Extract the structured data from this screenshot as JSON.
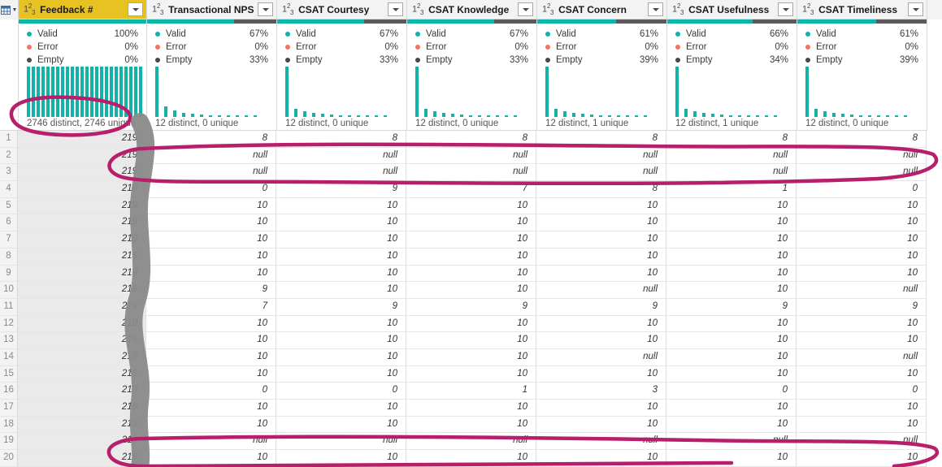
{
  "app": {
    "corner_icon": "table-select-all-icon",
    "type_icon_label": "123"
  },
  "columns": [
    {
      "name": "Feedback #",
      "selected": true,
      "type": "whole-number",
      "filter_icon": "filter-dropdown-icon",
      "quality": {
        "valid_label": "Valid",
        "valid": "100%",
        "error_label": "Error",
        "error": "0%",
        "empty_label": "Empty",
        "empty": "0%"
      },
      "quality_pct": {
        "valid": 100,
        "error": 0,
        "empty": 0
      },
      "distinct": "2746 distinct, 2746 unique",
      "histogram": [
        62,
        62,
        62,
        62,
        62,
        62,
        62,
        62,
        62,
        62,
        62,
        62,
        62,
        62,
        62,
        62,
        62,
        62,
        62,
        62,
        62,
        62,
        62,
        62
      ]
    },
    {
      "name": "Transactional NPS",
      "selected": false,
      "type": "whole-number",
      "filter_icon": "filter-dropdown-icon",
      "quality": {
        "valid_label": "Valid",
        "valid": "67%",
        "error_label": "Error",
        "error": "0%",
        "empty_label": "Empty",
        "empty": "33%"
      },
      "quality_pct": {
        "valid": 67,
        "error": 0,
        "empty": 33
      },
      "distinct": "12 distinct, 0 unique",
      "histogram": [
        62,
        13,
        8,
        5,
        4,
        3,
        2,
        2,
        2,
        2,
        2,
        2
      ]
    },
    {
      "name": "CSAT Courtesy",
      "selected": false,
      "type": "whole-number",
      "filter_icon": "filter-dropdown-icon",
      "quality": {
        "valid_label": "Valid",
        "valid": "67%",
        "error_label": "Error",
        "error": "0%",
        "empty_label": "Empty",
        "empty": "33%"
      },
      "quality_pct": {
        "valid": 67,
        "error": 0,
        "empty": 33
      },
      "distinct": "12 distinct, 0 unique",
      "histogram": [
        62,
        10,
        7,
        5,
        4,
        3,
        2,
        2,
        2,
        2,
        2,
        2
      ]
    },
    {
      "name": "CSAT Knowledge",
      "selected": false,
      "type": "whole-number",
      "filter_icon": "filter-dropdown-icon",
      "quality": {
        "valid_label": "Valid",
        "valid": "67%",
        "error_label": "Error",
        "error": "0%",
        "empty_label": "Empty",
        "empty": "33%"
      },
      "quality_pct": {
        "valid": 67,
        "error": 0,
        "empty": 33
      },
      "distinct": "12 distinct, 0 unique",
      "histogram": [
        62,
        10,
        7,
        5,
        4,
        3,
        2,
        2,
        2,
        2,
        2,
        2
      ]
    },
    {
      "name": "CSAT Concern",
      "selected": false,
      "type": "whole-number",
      "filter_icon": "filter-dropdown-icon",
      "quality": {
        "valid_label": "Valid",
        "valid": "61%",
        "error_label": "Error",
        "error": "0%",
        "empty_label": "Empty",
        "empty": "39%"
      },
      "quality_pct": {
        "valid": 61,
        "error": 0,
        "empty": 39
      },
      "distinct": "12 distinct, 1 unique",
      "histogram": [
        62,
        10,
        7,
        5,
        4,
        3,
        2,
        2,
        2,
        2,
        2,
        2
      ]
    },
    {
      "name": "CSAT Usefulness",
      "selected": false,
      "type": "whole-number",
      "filter_icon": "filter-dropdown-icon",
      "quality": {
        "valid_label": "Valid",
        "valid": "66%",
        "error_label": "Error",
        "error": "0%",
        "empty_label": "Empty",
        "empty": "34%"
      },
      "quality_pct": {
        "valid": 66,
        "error": 0,
        "empty": 34
      },
      "distinct": "12 distinct, 1 unique",
      "histogram": [
        62,
        10,
        7,
        5,
        4,
        3,
        2,
        2,
        2,
        2,
        2,
        2
      ]
    },
    {
      "name": "CSAT Timeliness",
      "selected": false,
      "type": "whole-number",
      "filter_icon": "filter-dropdown-icon",
      "quality": {
        "valid_label": "Valid",
        "valid": "61%",
        "error_label": "Error",
        "error": "0%",
        "empty_label": "Empty",
        "empty": "39%"
      },
      "quality_pct": {
        "valid": 61,
        "error": 0,
        "empty": 39
      },
      "distinct": "12 distinct, 0 unique",
      "histogram": [
        62,
        10,
        7,
        5,
        4,
        3,
        2,
        2,
        2,
        2,
        2,
        2
      ]
    }
  ],
  "rows": [
    {
      "n": "1",
      "cells": [
        "219",
        "8",
        "8",
        "8",
        "8",
        "8",
        "8"
      ]
    },
    {
      "n": "2",
      "cells": [
        "219",
        "null",
        "null",
        "null",
        "null",
        "null",
        "null"
      ]
    },
    {
      "n": "3",
      "cells": [
        "219",
        "null",
        "null",
        "null",
        "null",
        "null",
        "null"
      ]
    },
    {
      "n": "4",
      "cells": [
        "219",
        "0",
        "9",
        "7",
        "8",
        "1",
        "0"
      ]
    },
    {
      "n": "5",
      "cells": [
        "219",
        "10",
        "10",
        "10",
        "10",
        "10",
        "10"
      ]
    },
    {
      "n": "6",
      "cells": [
        "219",
        "10",
        "10",
        "10",
        "10",
        "10",
        "10"
      ]
    },
    {
      "n": "7",
      "cells": [
        "219",
        "10",
        "10",
        "10",
        "10",
        "10",
        "10"
      ]
    },
    {
      "n": "8",
      "cells": [
        "219",
        "10",
        "10",
        "10",
        "10",
        "10",
        "10"
      ]
    },
    {
      "n": "9",
      "cells": [
        "219",
        "10",
        "10",
        "10",
        "10",
        "10",
        "10"
      ]
    },
    {
      "n": "10",
      "cells": [
        "219",
        "9",
        "10",
        "10",
        "null",
        "10",
        "null"
      ]
    },
    {
      "n": "11",
      "cells": [
        "219",
        "7",
        "9",
        "9",
        "9",
        "9",
        "9"
      ]
    },
    {
      "n": "12",
      "cells": [
        "219",
        "10",
        "10",
        "10",
        "10",
        "10",
        "10"
      ]
    },
    {
      "n": "13",
      "cells": [
        "219",
        "10",
        "10",
        "10",
        "10",
        "10",
        "10"
      ]
    },
    {
      "n": "14",
      "cells": [
        "219",
        "10",
        "10",
        "10",
        "null",
        "10",
        "null"
      ]
    },
    {
      "n": "15",
      "cells": [
        "219",
        "10",
        "10",
        "10",
        "10",
        "10",
        "10"
      ]
    },
    {
      "n": "16",
      "cells": [
        "219",
        "0",
        "0",
        "1",
        "3",
        "0",
        "0"
      ]
    },
    {
      "n": "17",
      "cells": [
        "219",
        "10",
        "10",
        "10",
        "10",
        "10",
        "10"
      ]
    },
    {
      "n": "18",
      "cells": [
        "219",
        "10",
        "10",
        "10",
        "10",
        "10",
        "10"
      ]
    },
    {
      "n": "19",
      "cells": [
        "219",
        "null",
        "null",
        "null",
        "null",
        "null",
        "null"
      ]
    },
    {
      "n": "20",
      "cells": [
        "219",
        "10",
        "10",
        "10",
        "10",
        "10",
        "10"
      ]
    }
  ],
  "annotations": {
    "color": "#b81f6a",
    "redaction_color": "#8a8a8a",
    "marks": [
      "ellipse-around-distinct-count",
      "grey-redaction-over-feedback-values",
      "horizontal-loop-over-null-rows-2-3",
      "horizontal-loop-over-null-row-19"
    ]
  },
  "colors": {
    "selected_header": "#e8c222",
    "valid": "#0ab5ac",
    "error": "#f47068",
    "empty": "#4a4a4a",
    "histogram": "#12b2a6"
  }
}
